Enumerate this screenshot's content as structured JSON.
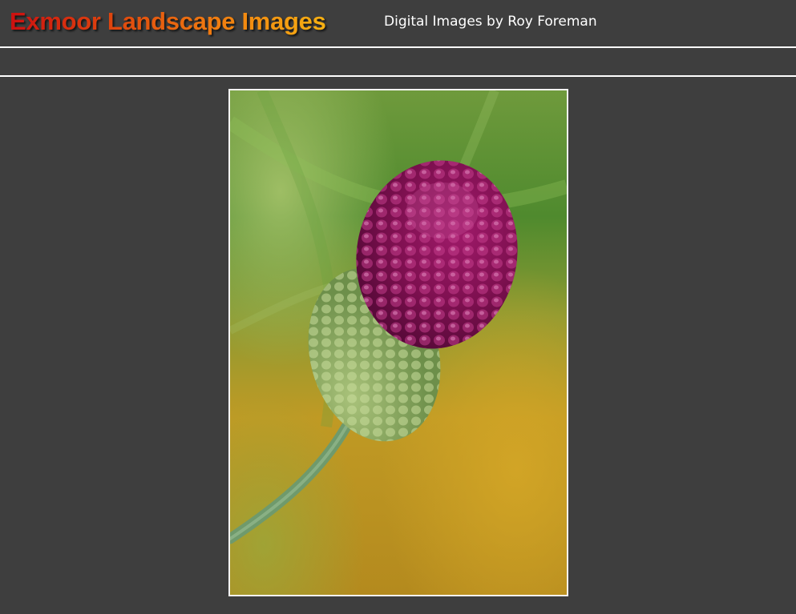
{
  "header": {
    "site_title": "Exmoor Landscape Images",
    "tagline": "Digital Images by Roy Foreman"
  },
  "colors": {
    "background": "#3e3e3e",
    "rule": "#ffffff",
    "title_gradient_start": "#cc1010",
    "title_gradient_end": "#f6b112",
    "tagline_text": "#ffffff"
  },
  "main": {
    "photo": {
      "subject": "allium-flower-photo"
    }
  }
}
